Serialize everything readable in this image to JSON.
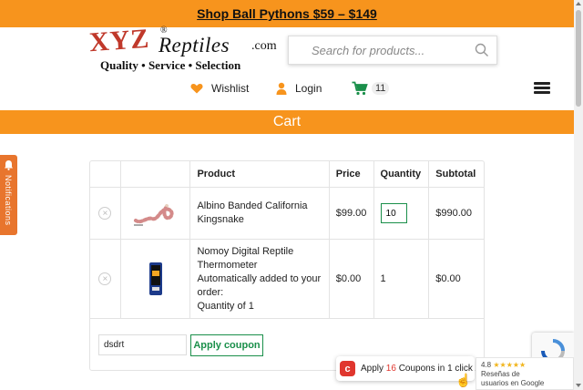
{
  "promo": {
    "text": "Shop Ball Pythons $59 – $149"
  },
  "logo": {
    "xyz": "XYZ",
    "reg": "®",
    "reptiles": "Reptiles",
    "dotcom": ".com",
    "tagline": "Quality  •  Service  •  Selection"
  },
  "search": {
    "placeholder": "Search for products..."
  },
  "nav": {
    "wishlist": "Wishlist",
    "login": "Login",
    "cart_count": "11"
  },
  "page": {
    "title": "Cart"
  },
  "notifications": {
    "label": "Notifications"
  },
  "table": {
    "headers": {
      "product": "Product",
      "price": "Price",
      "quantity": "Quantity",
      "subtotal": "Subtotal"
    },
    "rows": [
      {
        "name": "Albino Banded California Kingsnake",
        "price": "$99.00",
        "quantity": "10",
        "subtotal": "$990.00"
      },
      {
        "name": "Nomoy Digital Reptile Thermometer",
        "note": "Automatically added to your order:",
        "note2": "Quantity of 1",
        "price": "$0.00",
        "quantity": "1",
        "subtotal": "$0.00"
      }
    ],
    "remove_symbol": "×"
  },
  "coupon": {
    "value": "dsdrt",
    "button": "Apply coupon"
  },
  "popup": {
    "prefix": "Apply ",
    "count": "16",
    "suffix": " Coupons in 1 click"
  },
  "google_reviews": {
    "rating": "4.8",
    "stars": "★★★★★",
    "line1": "Reseñas de",
    "line2": "usuarios en Google"
  },
  "colors": {
    "brand_orange": "#f7941d",
    "green": "#1a8f4a",
    "notif": "#e8752d"
  }
}
